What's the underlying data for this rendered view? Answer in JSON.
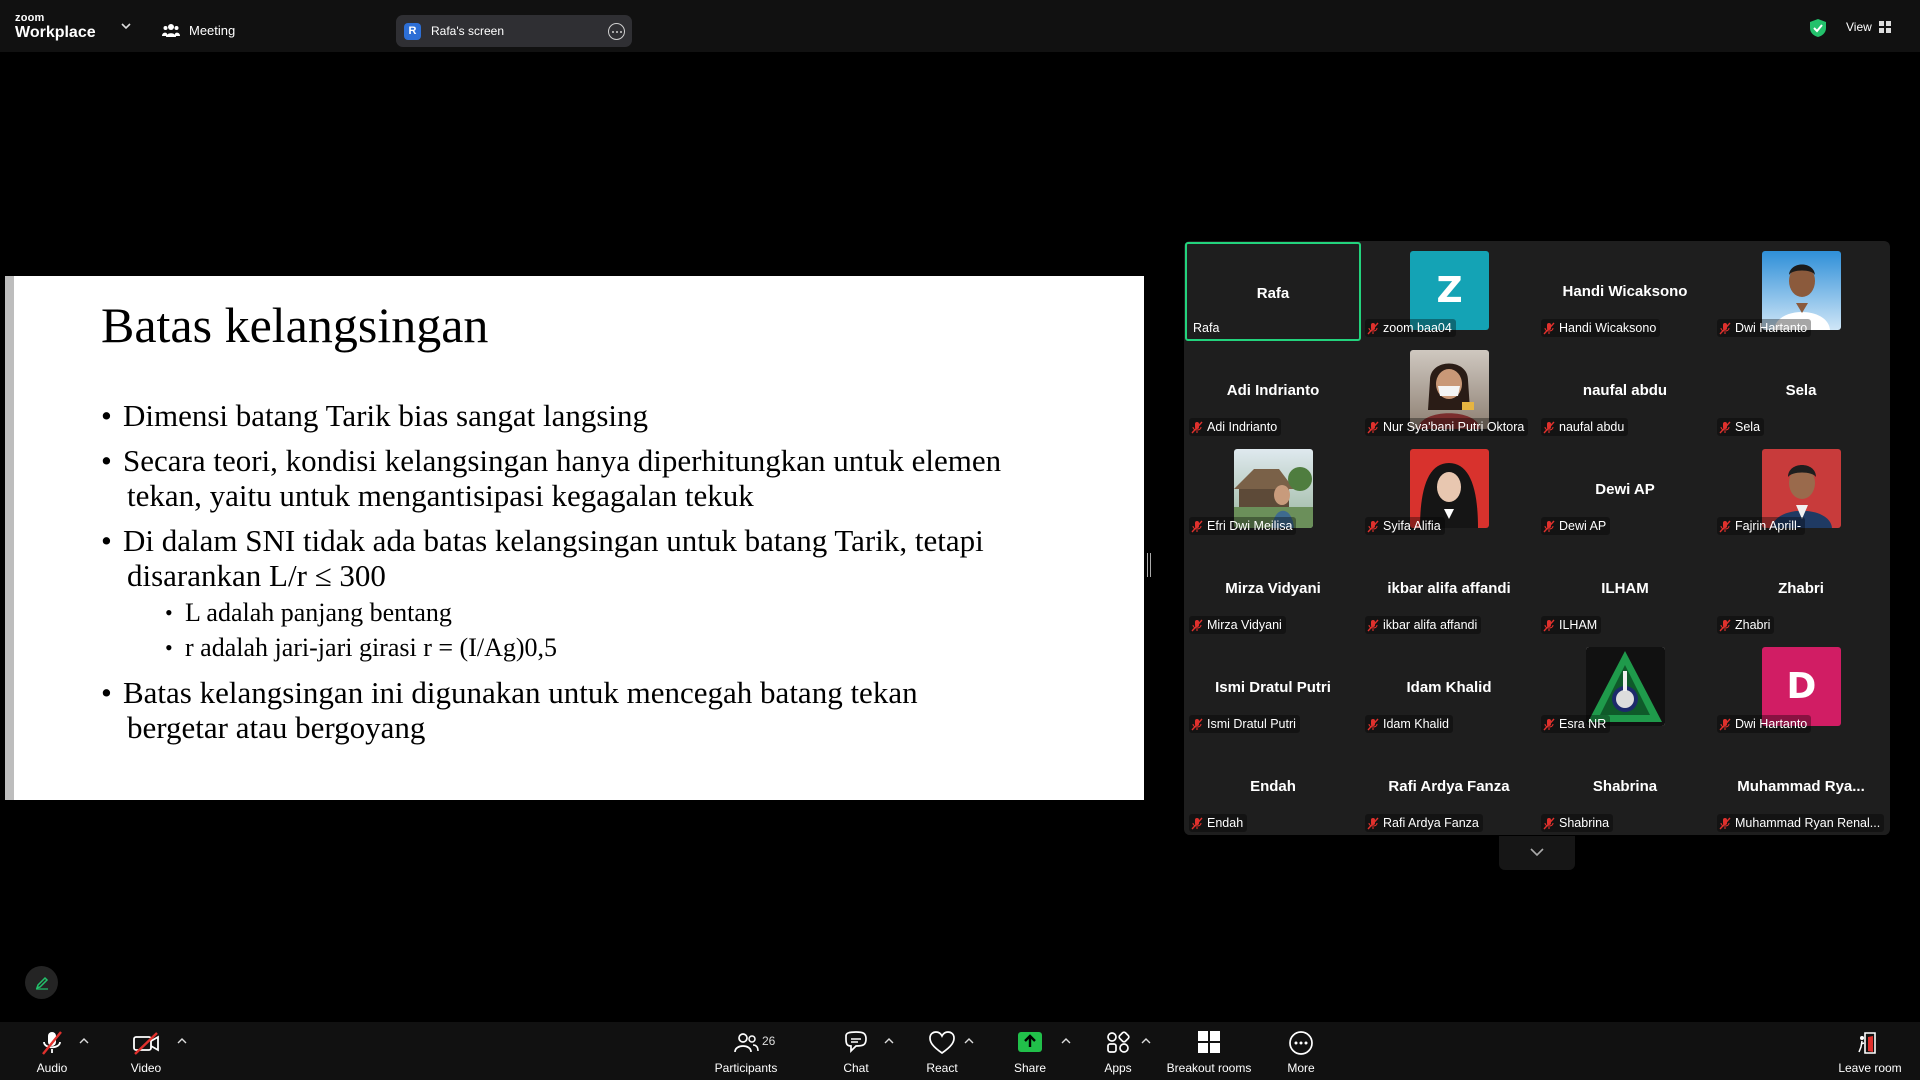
{
  "topbar": {
    "logo_line1": "zoom",
    "logo_line2": "Workplace",
    "meeting_label": "Meeting",
    "screen_pill_initial": "R",
    "screen_pill_label": "Rafa's screen",
    "view_label": "View",
    "shield_color": "#23c16b"
  },
  "slide": {
    "title": "Batas kelangsingan",
    "bullets": [
      {
        "text": "Dimensi batang Tarik bias sangat langsing"
      },
      {
        "text": "Secara teori, kondisi kelangsingan hanya diperhitungkan untuk elemen",
        "cont": "tekan, yaitu untuk mengantisipasi kegagalan tekuk"
      },
      {
        "text": "Di dalam SNI tidak ada batas kelangsingan untuk batang Tarik, tetapi",
        "cont": "disarankan L/r ≤ 300",
        "sub": [
          "L adalah panjang bentang",
          "r adalah jari-jari girasi r = (I/Ag)0,5"
        ]
      },
      {
        "text": "Batas kelangsingan ini digunakan untuk mencegah batang tekan",
        "cont": "bergetar atau bergoyang"
      }
    ]
  },
  "gallery": {
    "tiles": [
      {
        "name": "Rafa",
        "label": "Rafa",
        "type": "name",
        "active": true,
        "muted": false
      },
      {
        "name": "",
        "label": "zoom baa04",
        "type": "letter",
        "letter": "Z",
        "color": "#14a3b5",
        "muted": true
      },
      {
        "name": "Handi Wicaksono",
        "label": "Handi Wicaksono",
        "type": "name",
        "muted": true
      },
      {
        "name": "",
        "label": "Dwi Hartanto",
        "type": "photo-man-blue",
        "muted": true
      },
      {
        "name": "Adi Indrianto",
        "label": "Adi Indrianto",
        "type": "name",
        "muted": true
      },
      {
        "name": "",
        "label": "Nur Sya'bani Putri Oktora",
        "type": "photo-girl-mask",
        "muted": true
      },
      {
        "name": "naufal abdu",
        "label": "naufal abdu",
        "type": "name",
        "muted": true
      },
      {
        "name": "Sela",
        "label": "Sela",
        "type": "name",
        "muted": true
      },
      {
        "name": "",
        "label": "Efri Dwi Meilisa",
        "type": "photo-outdoor",
        "muted": true
      },
      {
        "name": "",
        "label": "Syifa Alifia",
        "type": "photo-hijab-red",
        "muted": true
      },
      {
        "name": "Dewi AP",
        "label": "Dewi AP",
        "type": "name",
        "muted": true
      },
      {
        "name": "",
        "label": "Fajrin Aprill-",
        "type": "photo-man-red",
        "muted": true
      },
      {
        "name": "Mirza Vidyani",
        "label": "Mirza Vidyani",
        "type": "name",
        "muted": true
      },
      {
        "name": "ikbar alifa affandi",
        "label": "ikbar alifa affandi",
        "type": "name",
        "muted": true
      },
      {
        "name": "ILHAM",
        "label": "ILHAM",
        "type": "name",
        "muted": true
      },
      {
        "name": "Zhabri",
        "label": "Zhabri",
        "type": "name",
        "muted": true
      },
      {
        "name": "Ismi Dratul Putri",
        "label": "Ismi Dratul Putri",
        "type": "name",
        "muted": true
      },
      {
        "name": "Idam Khalid",
        "label": "Idam Khalid",
        "type": "name",
        "muted": true
      },
      {
        "name": "",
        "label": "Esra NR",
        "type": "logo-triangle",
        "muted": true
      },
      {
        "name": "",
        "label": "Dwi Hartanto",
        "type": "letter",
        "letter": "D",
        "color": "#d11d64",
        "muted": true
      },
      {
        "name": "Endah",
        "label": "Endah",
        "type": "name",
        "muted": true
      },
      {
        "name": "Rafi Ardya Fanza",
        "label": "Rafi Ardya Fanza",
        "type": "name",
        "muted": true
      },
      {
        "name": "Shabrina",
        "label": "Shabrina",
        "type": "name",
        "muted": true
      },
      {
        "name": "Muhammad  Rya...",
        "label": "Muhammad Ryan Renal...",
        "type": "name",
        "muted": true
      }
    ]
  },
  "toolbar": {
    "audio": "Audio",
    "video": "Video",
    "participants": "Participants",
    "participants_count": "26",
    "chat": "Chat",
    "react": "React",
    "share": "Share",
    "apps": "Apps",
    "breakout": "Breakout rooms",
    "more": "More",
    "leave": "Leave room",
    "share_color": "#21c04a",
    "muted_color": "#e0312d"
  }
}
